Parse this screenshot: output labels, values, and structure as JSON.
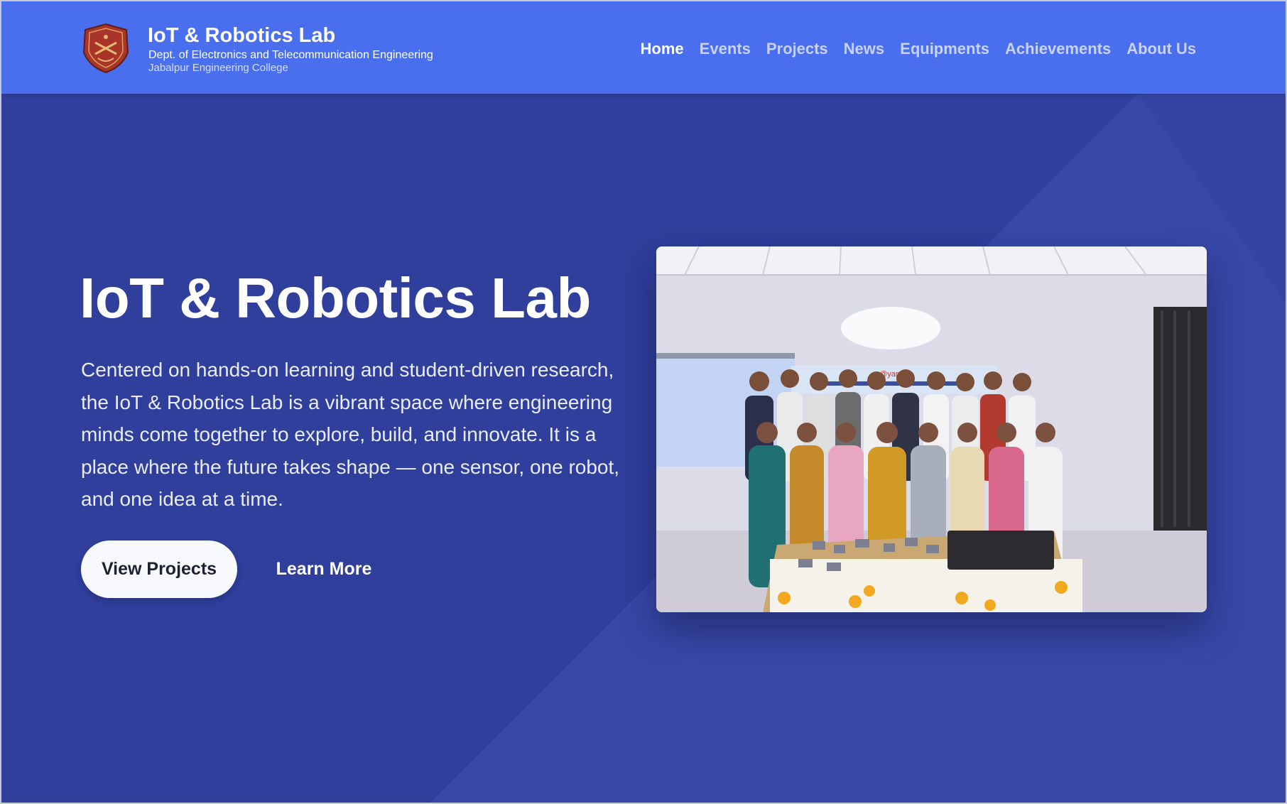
{
  "header": {
    "logo_icon": "college-crest-icon",
    "title": "IoT & Robotics Lab",
    "subtitle": "Dept. of Electronics and Telecommunication Engineering",
    "institution": "Jabalpur Engineering College"
  },
  "nav": {
    "items": [
      {
        "label": "Home",
        "active": true
      },
      {
        "label": "Events",
        "active": false
      },
      {
        "label": "Projects",
        "active": false
      },
      {
        "label": "News",
        "active": false
      },
      {
        "label": "Equipments",
        "active": false
      },
      {
        "label": "Achievements",
        "active": false
      },
      {
        "label": "About Us",
        "active": false
      }
    ]
  },
  "hero": {
    "title": "IoT & Robotics Lab",
    "description": "Centered on hands-on learning and student-driven research, the IoT & Robotics Lab is a vibrant space where engineering minds come together to explore, build, and innovate. It is a place where the future takes shape — one sensor, one robot, and one idea at a time.",
    "primary_button": "View Projects",
    "secondary_button": "Learn More",
    "photo": {
      "banner_brand": "@yantra"
    }
  },
  "colors": {
    "header_bg": "#4a6fee",
    "hero_bg": "#2f3f9b",
    "nav_active": "#ffffff",
    "nav_inactive": "#c9d2f8"
  }
}
